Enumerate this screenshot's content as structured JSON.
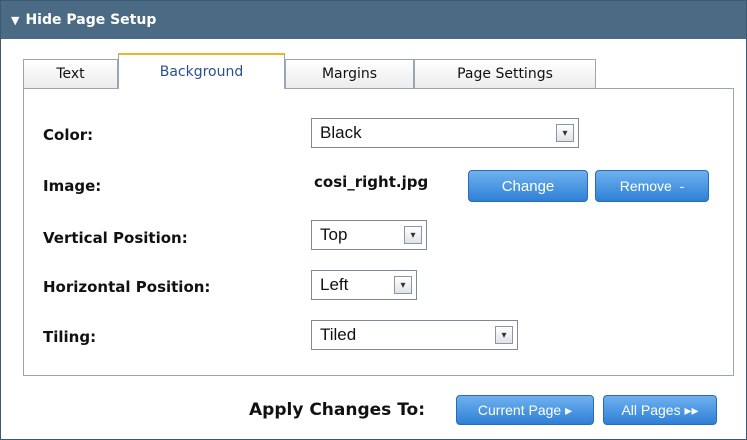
{
  "header": {
    "arrow": "▼",
    "title": "Hide Page Setup"
  },
  "tabs": [
    {
      "label": "Text"
    },
    {
      "label": "Background"
    },
    {
      "label": "Margins"
    },
    {
      "label": "Page Settings"
    }
  ],
  "form": {
    "color": {
      "label": "Color:",
      "value": "Black"
    },
    "image": {
      "label": "Image:",
      "filename": "cosi_right.jpg",
      "change_label": "Change",
      "remove_label": "Remove  -"
    },
    "vertical": {
      "label": "Vertical Position:",
      "value": "Top"
    },
    "horizontal": {
      "label": "Horizontal Position:",
      "value": "Left"
    },
    "tiling": {
      "label": "Tiling:",
      "value": "Tiled"
    }
  },
  "apply": {
    "label": "Apply Changes To:",
    "current_page": "Current Page ▸",
    "all_pages": "All Pages ▸▸"
  },
  "icons": {
    "dropdown": "▾"
  },
  "colors": {
    "header_bg": "#4b6b85",
    "button_blue": "#2e80d6",
    "active_tab_accent": "#f0b429"
  }
}
